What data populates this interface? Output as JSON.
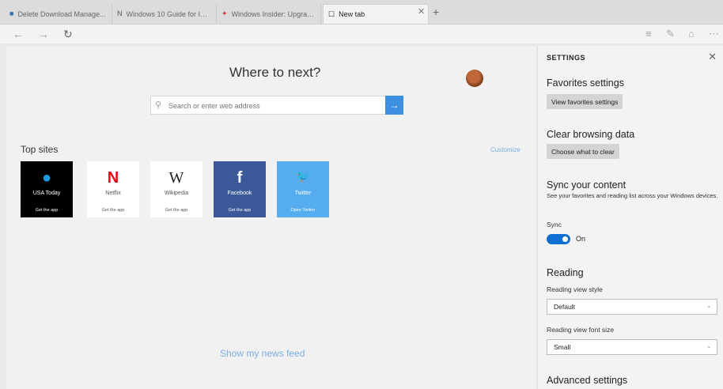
{
  "tabs": [
    {
      "label": "Delete Download Manage...",
      "icon": "■",
      "color": "#2f6fbe"
    },
    {
      "label": "Windows 10 Guide for IT pr...",
      "icon": "N",
      "color": "#555555"
    },
    {
      "label": "Windows Insider: Upgrade...",
      "icon": "✦",
      "color": "#d43a3a"
    },
    {
      "label": "New tab",
      "icon": "☐",
      "color": "#555555"
    }
  ],
  "tab_close": "✕",
  "new_tab_icon": "+",
  "nav": {
    "back": "←",
    "forward": "→",
    "refresh": "↻"
  },
  "toolbar": {
    "hub": "≡",
    "note": "✎",
    "share": "⌂",
    "more": "⋯"
  },
  "page": {
    "title": "Where to next?",
    "search_placeholder": "Search or enter web address",
    "search_icon": "⚲",
    "go_icon": "→",
    "top_sites_label": "Top sites",
    "customize": "Customize",
    "news_feed": "Show my news feed"
  },
  "top_sites": [
    {
      "name": "USA Today",
      "sub": "Get the app",
      "icon": "●",
      "bg": "#000000",
      "fg": "#ffffff",
      "icon_color": "#1e9ae0"
    },
    {
      "name": "Netflix",
      "sub": "Get the app",
      "icon": "N",
      "bg": "#ffffff",
      "fg": "#555555",
      "icon_color": "#e50914"
    },
    {
      "name": "Wikipedia",
      "sub": "Get the app",
      "icon": "W",
      "bg": "#ffffff",
      "fg": "#555555",
      "icon_color": "#222222"
    },
    {
      "name": "Facebook",
      "sub": "Get the app",
      "icon": "f",
      "bg": "#3b5998",
      "fg": "#ffffff",
      "icon_color": "#ffffff"
    },
    {
      "name": "Twitter",
      "sub": "Open Twitter",
      "icon": "🐦",
      "bg": "#55acee",
      "fg": "#ffffff",
      "icon_color": "#ffffff"
    }
  ],
  "settings": {
    "title": "SETTINGS",
    "close": "✕",
    "favorites_heading": "Favorites settings",
    "favorites_button": "View favorites settings",
    "clear_heading": "Clear browsing data",
    "clear_button": "Choose what to clear",
    "sync_heading": "Sync your content",
    "sync_desc": "See your favorites and reading list across your Windows devices.",
    "sync_label": "Sync",
    "sync_state": "On",
    "reading_heading": "Reading",
    "reading_style_label": "Reading view style",
    "reading_style_value": "Default",
    "reading_font_label": "Reading view font size",
    "reading_font_value": "Small",
    "chevron": "⌄",
    "advanced_heading": "Advanced settings"
  }
}
